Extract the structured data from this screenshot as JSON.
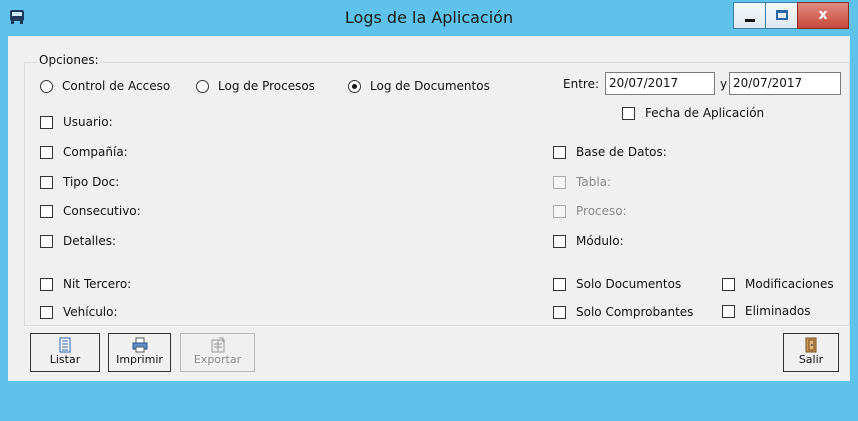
{
  "window": {
    "title": "Logs de la Aplicación",
    "close_glyph": "x",
    "accent_color": "#5fc2ea"
  },
  "options_group": {
    "title": "Opciones:"
  },
  "log_type": {
    "options": [
      {
        "label": "Control de Acceso",
        "selected": false
      },
      {
        "label": "Log de Procesos",
        "selected": false
      },
      {
        "label": "Log de Documentos",
        "selected": true
      }
    ]
  },
  "date_range": {
    "entre_label": "Entre:",
    "from": "20/07/2017",
    "y_label": "y",
    "to": "20/07/2017",
    "fecha_aplicacion_label": "Fecha de Aplicación"
  },
  "left_filters": [
    {
      "label": "Usuario:"
    },
    {
      "label": "Compañía:"
    },
    {
      "label": "Tipo Doc:"
    },
    {
      "label": "Consecutivo:"
    },
    {
      "label": "Detalles:"
    },
    {
      "label": "Nit Tercero:"
    },
    {
      "label": "Vehículo:"
    }
  ],
  "right_filters": [
    {
      "label": "Base de Datos:",
      "enabled": true
    },
    {
      "label": "Tabla:",
      "enabled": false
    },
    {
      "label": "Proceso:",
      "enabled": false
    },
    {
      "label": "Módulo:",
      "enabled": true
    }
  ],
  "extra_filters": {
    "solo_documentos": "Solo Documentos",
    "solo_comprobantes": "Solo Comprobantes",
    "modificaciones": "Modificaciones",
    "eliminados": "Eliminados"
  },
  "toolbar": {
    "listar": "Listar",
    "imprimir": "Imprimir",
    "exportar": "Exportar",
    "salir": "Salir"
  },
  "icons": {
    "app": "bus-icon",
    "listar": "list-icon",
    "imprimir": "printer-icon",
    "exportar": "export-icon",
    "salir": "exit-door-icon"
  }
}
